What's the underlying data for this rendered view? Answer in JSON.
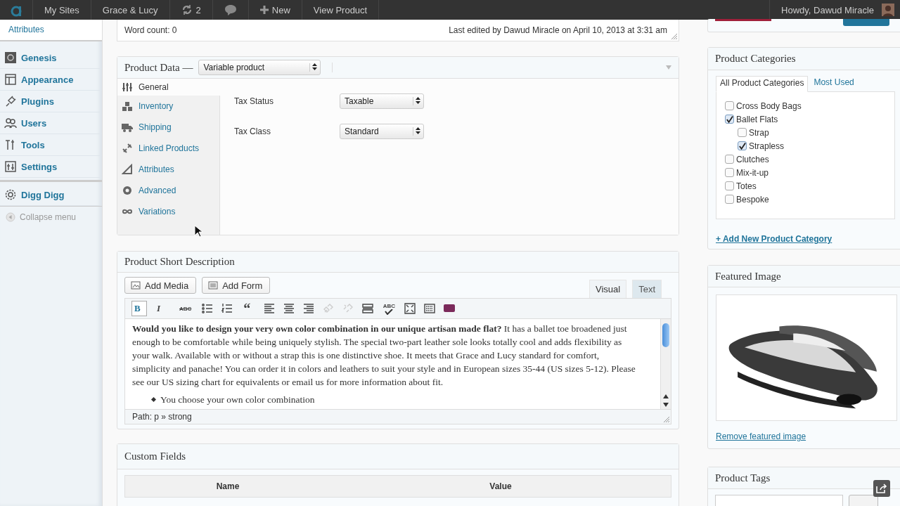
{
  "admin_bar": {
    "items": [
      {
        "kind": "logo"
      },
      {
        "kind": "text",
        "label": "My Sites"
      },
      {
        "kind": "text",
        "label": "Grace & Lucy"
      },
      {
        "kind": "updates",
        "label": "2"
      },
      {
        "kind": "comments"
      },
      {
        "kind": "new",
        "label": "New"
      },
      {
        "kind": "text",
        "label": "View Product"
      }
    ],
    "greeting": "Howdy, Dawud Miracle"
  },
  "sidebar": {
    "submenu_item": "Attributes",
    "items": [
      {
        "label": "Genesis",
        "kind": "genesis"
      },
      {
        "label": "Appearance",
        "kind": "appearance"
      },
      {
        "label": "Plugins",
        "kind": "plugins"
      },
      {
        "label": "Users",
        "kind": "users"
      },
      {
        "label": "Tools",
        "kind": "tools"
      },
      {
        "label": "Settings",
        "kind": "settings"
      }
    ],
    "plugin_items": [
      {
        "label": "Digg Digg",
        "kind": "gear"
      }
    ],
    "collapse": "Collapse menu"
  },
  "editor_status": {
    "word_count": "Word count: 0",
    "last_edited": "Last edited by Dawud Miracle on April 10, 2013 at 3:31 am"
  },
  "product_data": {
    "title": "Product Data —",
    "type": "Variable product",
    "tabs": [
      {
        "label": "General",
        "kind": "sliders",
        "selected": true
      },
      {
        "label": "Inventory",
        "kind": "boxes",
        "selected": false
      },
      {
        "label": "Shipping",
        "kind": "truck",
        "selected": false
      },
      {
        "label": "Linked Products",
        "kind": "link",
        "selected": false
      },
      {
        "label": "Attributes",
        "kind": "triangle",
        "selected": false
      },
      {
        "label": "Advanced",
        "kind": "gear",
        "selected": false
      },
      {
        "label": "Variations",
        "kind": "infinity",
        "selected": false
      }
    ],
    "fields": [
      {
        "label": "Tax Status",
        "value": "Taxable"
      },
      {
        "label": "Tax Class",
        "value": "Standard"
      }
    ]
  },
  "short_description": {
    "title": "Product Short Description",
    "buttons": [
      {
        "label": "Add Media",
        "kind": "media"
      },
      {
        "label": "Add Form",
        "kind": "form"
      }
    ],
    "mode_tabs": [
      {
        "label": "Visual",
        "selected": true
      },
      {
        "label": "Text",
        "selected": false
      }
    ],
    "toolbar": [
      {
        "kind": "bold",
        "label": "B",
        "selected": true
      },
      {
        "kind": "italic",
        "label": "I",
        "selected": false
      },
      {
        "kind": "strike",
        "label": "ABC",
        "selected": false
      },
      {
        "kind": "ul",
        "selected": false
      },
      {
        "kind": "ol",
        "selected": false
      },
      {
        "kind": "quote",
        "label": "“",
        "selected": false
      },
      {
        "kind": "left",
        "selected": false
      },
      {
        "kind": "center",
        "selected": false
      },
      {
        "kind": "right",
        "selected": false
      },
      {
        "kind": "link",
        "disabled": true,
        "selected": false
      },
      {
        "kind": "unlink",
        "disabled": true,
        "selected": false
      },
      {
        "kind": "more",
        "selected": false
      },
      {
        "kind": "spell",
        "label": "ABC",
        "selected": false
      },
      {
        "kind": "fullscreen",
        "selected": false
      },
      {
        "kind": "kitchen",
        "selected": false
      },
      {
        "kind": "woo",
        "selected": false
      }
    ],
    "paragraph": "**Would you like to design your very own color combination in our unique artisan made flat?** It has a ballet toe broadened just enough to be comfortable while being uniquely stylish. The special two-part leather sole looks totally cool and adds flexibility as your walk. Available with or without a strap this is one distinctive shoe. It meets that Grace and Lucy standard for comfort, simplicity and panache! You can order it in colors and leathers to suit your style and in European sizes 35-44 (US sizes 5-12). Please see our US sizing chart for equivalents or email us for more information about fit.",
    "bullets": [
      "You choose your own color combination"
    ],
    "path": "Path: p » strong"
  },
  "custom_fields": {
    "title": "Custom Fields",
    "columns": [
      "Name",
      "Value"
    ]
  },
  "product_categories": {
    "title": "Product Categories",
    "tabs": [
      {
        "label": "All Product Categories",
        "selected": true
      },
      {
        "label": "Most Used",
        "selected": false
      }
    ],
    "items": [
      {
        "label": "Cross Body Bags",
        "checked": false
      },
      {
        "label": "Ballet Flats",
        "checked": true,
        "children": [
          {
            "label": "Strap",
            "checked": false
          },
          {
            "label": "Strapless",
            "checked": true
          }
        ]
      },
      {
        "label": "Clutches",
        "checked": false
      },
      {
        "label": "Mix-it-up",
        "checked": false
      },
      {
        "label": "Totes",
        "checked": false
      },
      {
        "label": "Bespoke",
        "checked": false
      }
    ],
    "add_link": "+ Add New Product Category"
  },
  "featured_image": {
    "title": "Featured Image",
    "remove_link": "Remove featured image"
  },
  "product_tags": {
    "title": "Product Tags"
  }
}
